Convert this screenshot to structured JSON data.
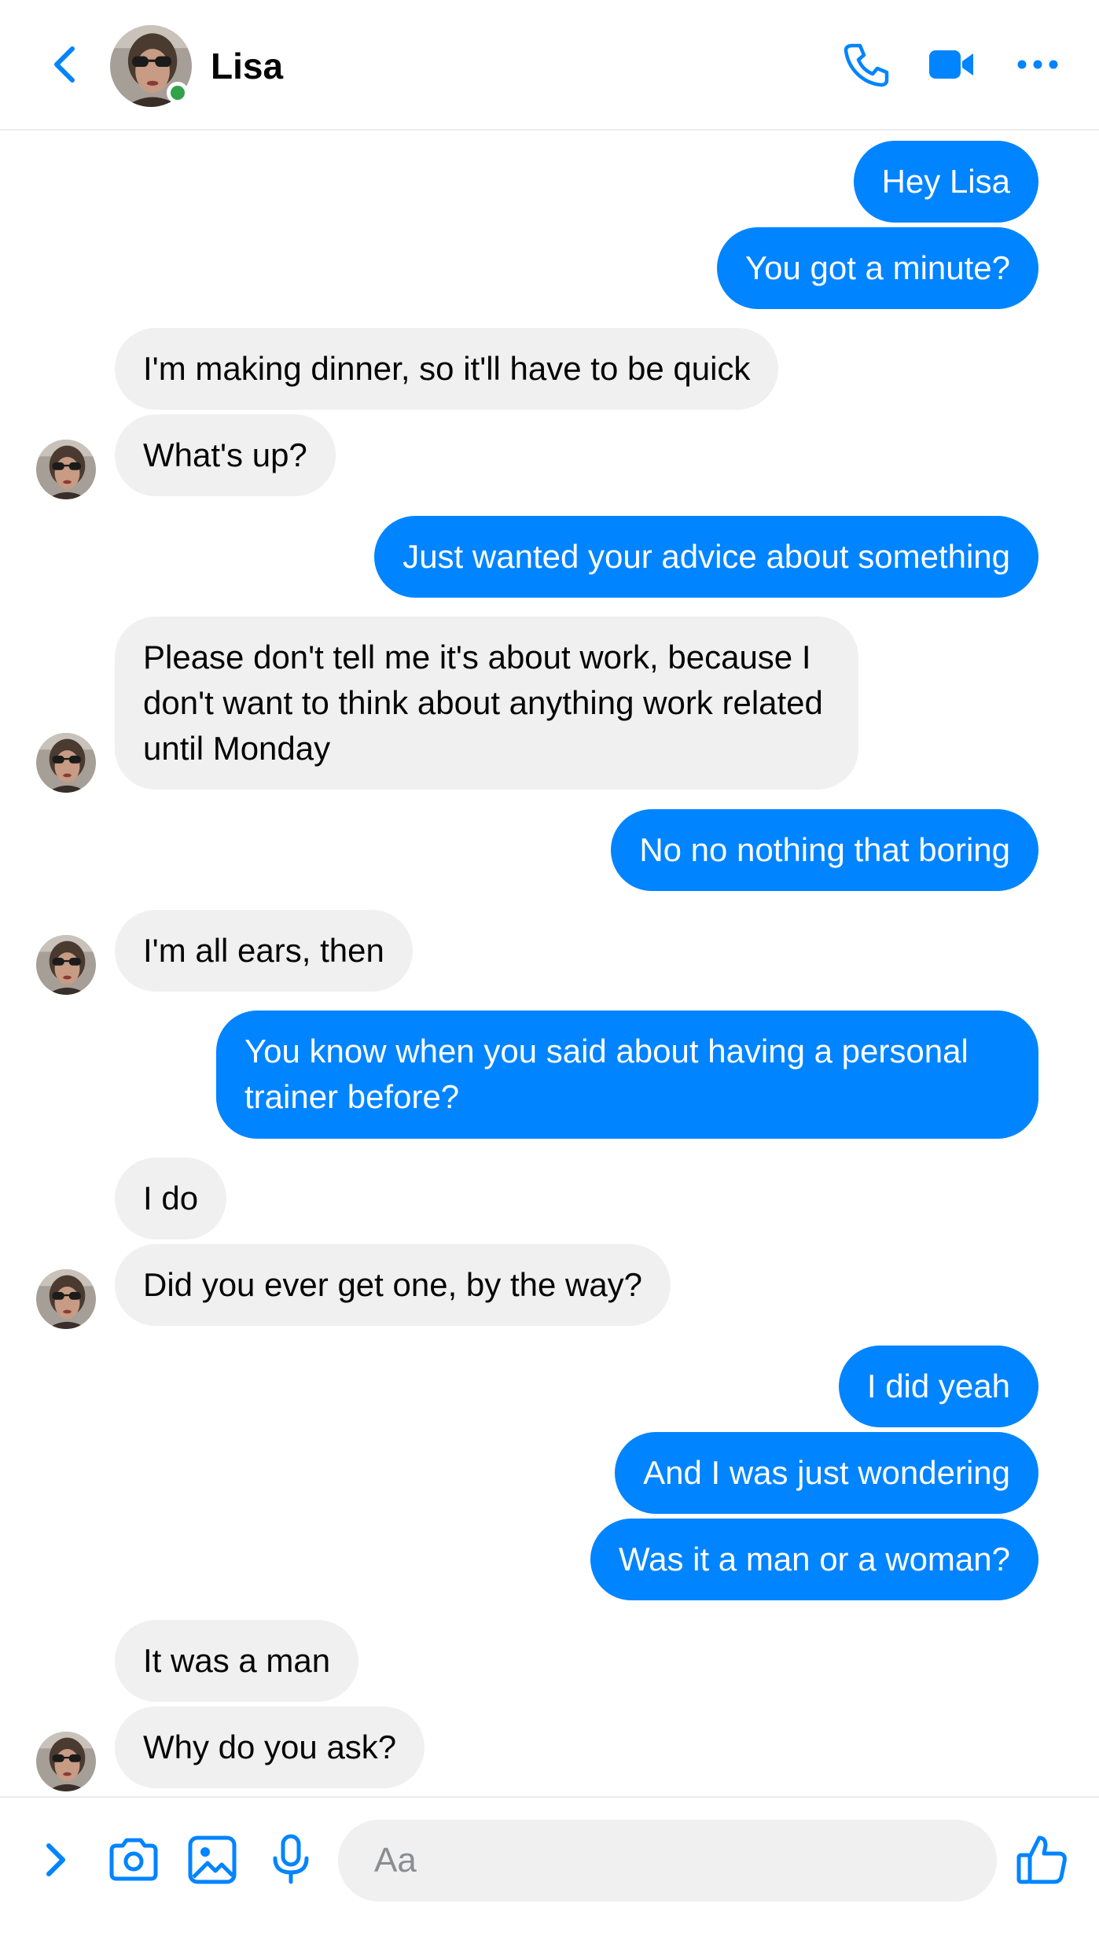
{
  "header": {
    "contact_name": "Lisa",
    "online": true,
    "icons": [
      "back-chevron-icon",
      "phone-icon",
      "video-camera-icon",
      "more-dots-icon"
    ]
  },
  "messages": [
    {
      "side": "out",
      "text": "Hey Lisa"
    },
    {
      "side": "out",
      "text": "You got a minute?"
    },
    {
      "side": "in",
      "text": "I'm making dinner, so it'll have to be quick"
    },
    {
      "side": "in",
      "text": "What's up?"
    },
    {
      "side": "out",
      "text": "Just wanted your advice about something"
    },
    {
      "side": "in",
      "text": "Please don't tell me it's about work, because I don't want to think about anything work related until Monday"
    },
    {
      "side": "out",
      "text": "No no nothing that boring"
    },
    {
      "side": "in",
      "text": "I'm all ears, then"
    },
    {
      "side": "out",
      "text": "You know when you said about having a personal trainer before?"
    },
    {
      "side": "in",
      "text": "I do"
    },
    {
      "side": "in",
      "text": "Did you ever get one, by the way?"
    },
    {
      "side": "out",
      "text": "I did yeah"
    },
    {
      "side": "out",
      "text": "And I was just wondering"
    },
    {
      "side": "out",
      "text": "Was it a man or a woman?"
    },
    {
      "side": "in",
      "text": "It was a man"
    },
    {
      "side": "in",
      "text": "Why do you ask?"
    }
  ],
  "composer": {
    "placeholder": "Aa",
    "icons": [
      "expand-chevron-icon",
      "camera-icon",
      "gallery-icon",
      "microphone-icon",
      "thumbs-up-icon"
    ]
  },
  "colors": {
    "accent": "#0084ff",
    "incoming_bubble": "#f0f0f0",
    "online": "#31a24c"
  }
}
